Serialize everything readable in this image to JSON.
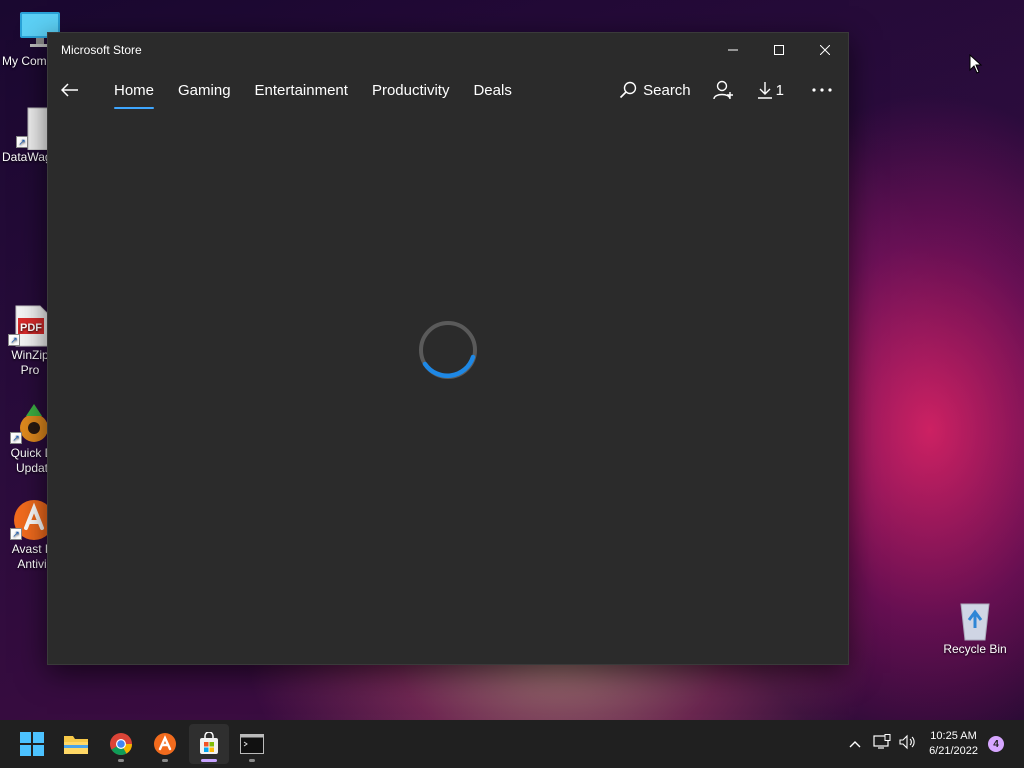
{
  "desktop": {
    "icons": [
      {
        "label": "My Com"
      },
      {
        "label": "DataWag"
      },
      {
        "label": "WinZip\nPro"
      },
      {
        "label": "Quick D\nUpdat"
      },
      {
        "label": "Avast F\nAntivi"
      },
      {
        "label": "Recycle Bin"
      }
    ]
  },
  "window": {
    "title": "Microsoft Store",
    "tabs": [
      "Home",
      "Gaming",
      "Entertainment",
      "Productivity",
      "Deals"
    ],
    "active_tab": "Home",
    "search_label": "Search",
    "downloads_count": "1",
    "accent_color": "#3ea6ff"
  },
  "taskbar": {
    "apps": [
      "start-icon",
      "file-explorer-icon",
      "chrome-icon",
      "avast-icon",
      "microsoft-store-icon",
      "terminal-icon"
    ],
    "clock_time": "10:25 AM",
    "clock_date": "6/21/2022",
    "notification_count": "4"
  }
}
